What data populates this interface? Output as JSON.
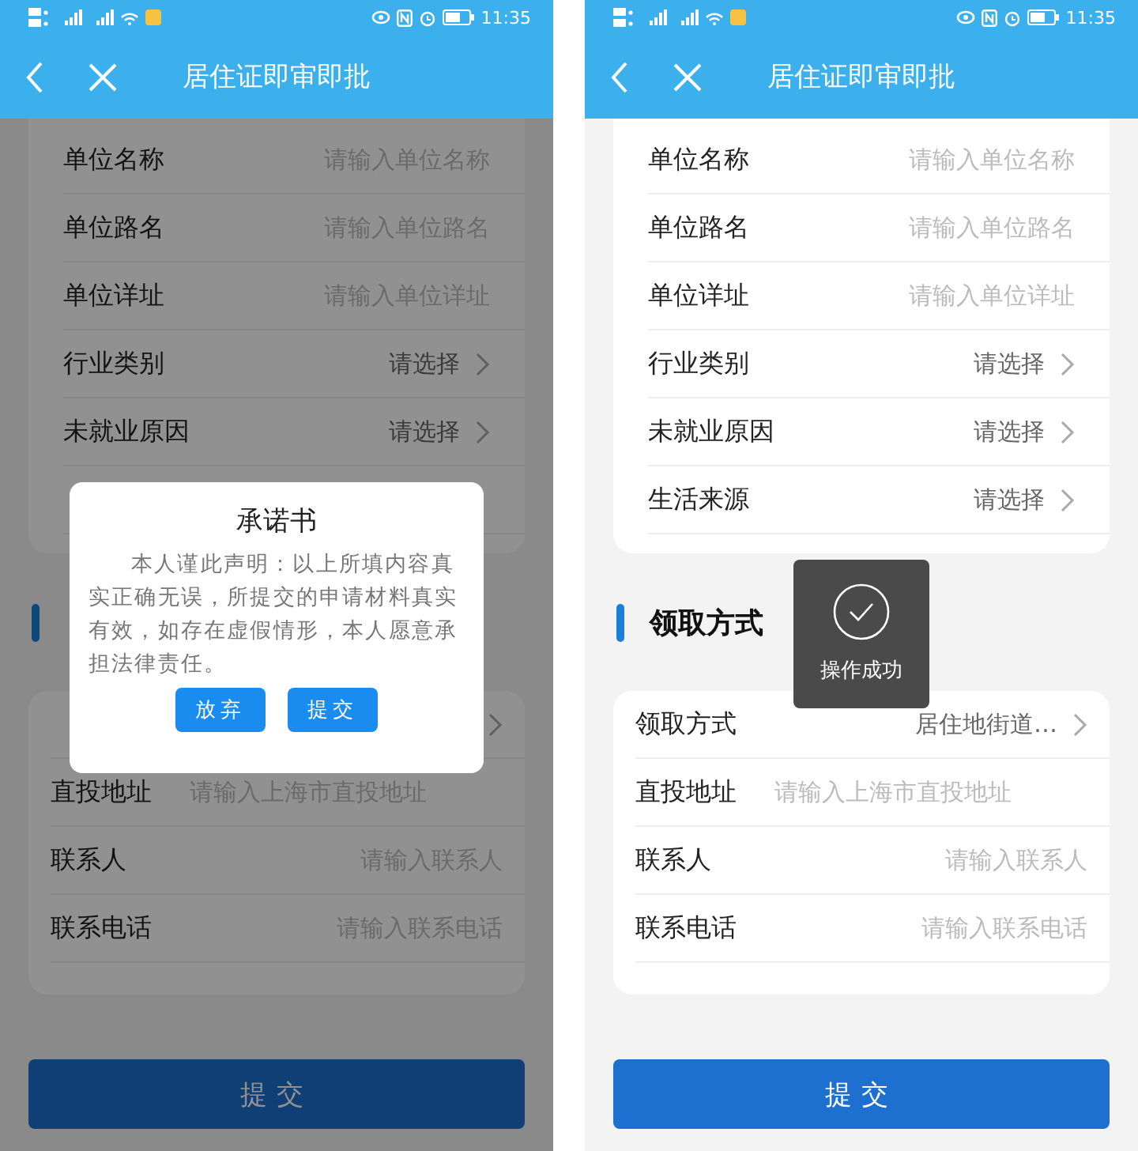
{
  "screens": [
    {
      "status_bar": {
        "time": "11:35"
      },
      "nav": {
        "title": "居住证即审即批"
      },
      "dimmed": true,
      "card_1": [
        {
          "kind": "input",
          "label": "单位名称",
          "placeholder": "请输入单位名称"
        },
        {
          "kind": "input",
          "label": "单位路名",
          "placeholder": "请输入单位路名"
        },
        {
          "kind": "input",
          "label": "单位详址",
          "placeholder": "请输入单位详址"
        },
        {
          "kind": "select",
          "label": "行业类别",
          "value": "请选择"
        },
        {
          "kind": "select",
          "label": "未就业原因",
          "value": "请选择"
        },
        {
          "kind": "blank"
        }
      ],
      "card_2": [
        {
          "kind": "select"
        },
        {
          "kind": "inline",
          "label": "直投地址",
          "placeholder": "请输入上海市直投地址"
        },
        {
          "kind": "input",
          "label": "联系人",
          "placeholder": "请输入联系人"
        },
        {
          "kind": "input",
          "label": "联系电话",
          "placeholder": "请输入联系电话"
        }
      ],
      "submit_button": "提交",
      "dialog": {
        "title": "承诺书",
        "body": "本人谨此声明：以上所填内容真实正确无误，所提交的申请材料真实有效，如存在虚假情形，本人愿意承担法律责任。",
        "buttons": [
          "放弃",
          "提交"
        ]
      }
    },
    {
      "status_bar": {
        "time": "11:35"
      },
      "nav": {
        "title": "居住证即审即批"
      },
      "dimmed": false,
      "card_1": [
        {
          "kind": "input",
          "label": "单位名称",
          "placeholder": "请输入单位名称"
        },
        {
          "kind": "input",
          "label": "单位路名",
          "placeholder": "请输入单位路名"
        },
        {
          "kind": "input",
          "label": "单位详址",
          "placeholder": "请输入单位详址"
        },
        {
          "kind": "select",
          "label": "行业类别",
          "value": "请选择"
        },
        {
          "kind": "select",
          "label": "未就业原因",
          "value": "请选择"
        },
        {
          "kind": "select",
          "label": "生活来源",
          "value": "请选择"
        }
      ],
      "section_title": "领取方式",
      "card_2": [
        {
          "kind": "select",
          "label": "领取方式",
          "value": "居住地街道…"
        },
        {
          "kind": "inline",
          "label": "直投地址",
          "placeholder": "请输入上海市直投地址"
        },
        {
          "kind": "input",
          "label": "联系人",
          "placeholder": "请输入联系人"
        },
        {
          "kind": "input",
          "label": "联系电话",
          "placeholder": "请输入联系电话"
        }
      ],
      "submit_button": "提交",
      "toast": {
        "text": "操作成功"
      }
    }
  ]
}
